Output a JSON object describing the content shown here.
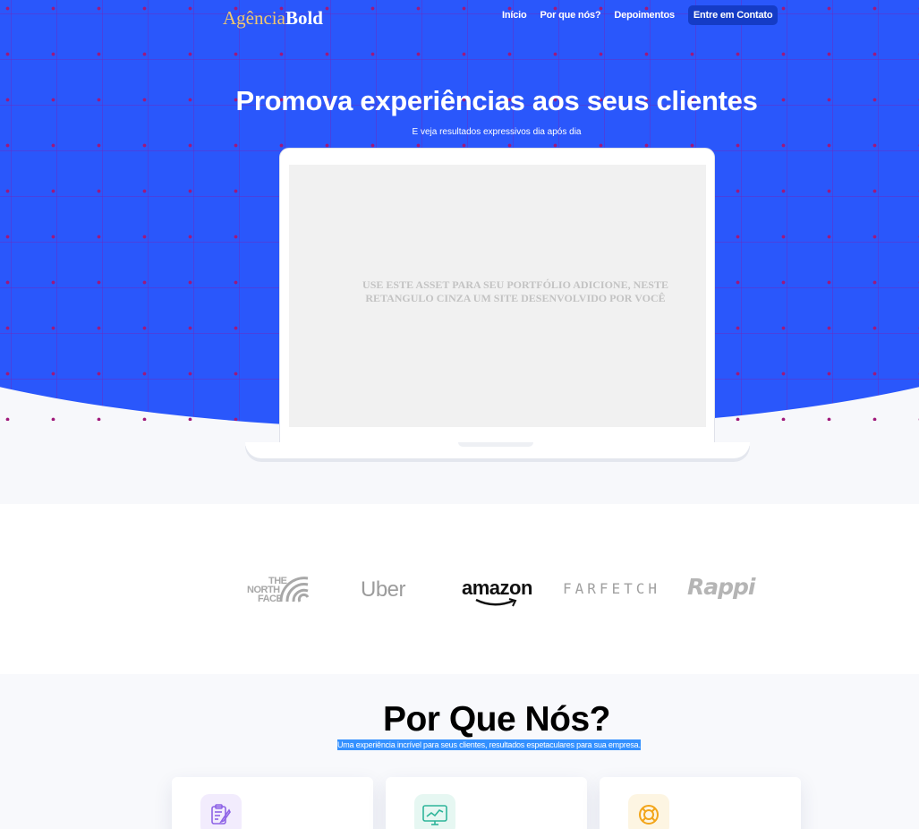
{
  "brand": {
    "part1": "Agência",
    "part2": "Bold"
  },
  "nav": {
    "links": [
      "Início",
      "Por que nós?",
      "Depoimentos"
    ],
    "cta": "Entre em Contato"
  },
  "hero": {
    "title": "Promova experiências aos seus clientes",
    "subtitle": "E veja resultados expressivos dia após dia",
    "screen_text": "USE ESTE ASSET PARA SEU PORTFÓLIO ADICIONE, NESTE RETANGULO CINZA UM SITE DESENVOLVIDO POR VOCÊ"
  },
  "logos": {
    "north_face": [
      "THE",
      "NORTH",
      "FACE"
    ],
    "uber": "Uber",
    "amazon": "amazon",
    "farfetch": "FARFETCH",
    "rappi": "Rappi"
  },
  "why": {
    "title": "Por Que Nós?",
    "subtitle": "Uma experiência incrível para seus clientes, resultados espetaculares para sua empresa."
  },
  "cards": [
    {
      "icon": "clipboard-edit-icon",
      "icon_color": "#8e63e6",
      "icon_bg": "#f2ecfd"
    },
    {
      "icon": "monitor-chart-icon",
      "icon_color": "#2fb59a",
      "icon_bg": "#e6f7f2"
    },
    {
      "icon": "lifebuoy-icon",
      "icon_color": "#f2a51a",
      "icon_bg": "#fdf5e2"
    }
  ],
  "colors": {
    "hero_blue": "#2a57fb",
    "cta_bg": "#153cc6",
    "brand_gold": "#f1c76d",
    "highlight": "#3390ff"
  }
}
